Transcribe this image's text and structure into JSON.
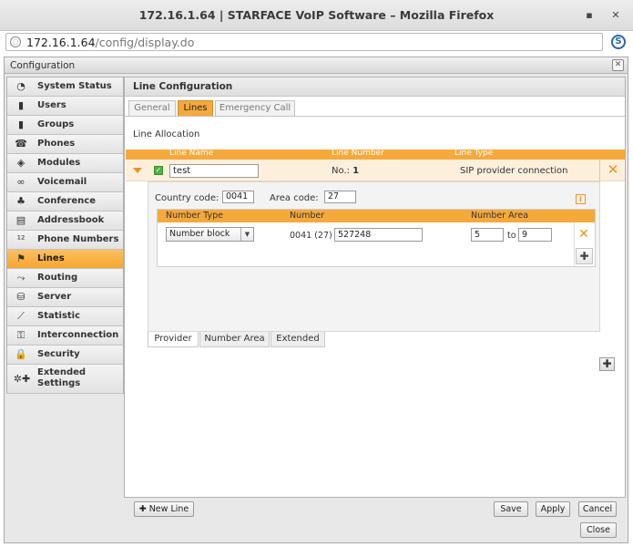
{
  "browser": {
    "title": "172.16.1.64 | STARFACE VoIP Software – Mozilla Firefox",
    "url_host": "172.16.1.64",
    "url_path": "/config/display.do",
    "minimize": "▪",
    "close": "✕",
    "extension": "S"
  },
  "dialog": {
    "title": "Configuration",
    "close": "✕"
  },
  "sidebar": {
    "items": [
      {
        "label": "System Status",
        "icon": "◔"
      },
      {
        "label": "Users",
        "icon": "▮"
      },
      {
        "label": "Groups",
        "icon": "▮"
      },
      {
        "label": "Phones",
        "icon": "☎"
      },
      {
        "label": "Modules",
        "icon": "◈"
      },
      {
        "label": "Voicemail",
        "icon": "∞"
      },
      {
        "label": "Conference",
        "icon": "♣"
      },
      {
        "label": "Addressbook",
        "icon": "▤"
      },
      {
        "label": "Phone Numbers",
        "icon": "¹²"
      },
      {
        "label": "Lines",
        "icon": "⚑"
      },
      {
        "label": "Routing",
        "icon": "⤳"
      },
      {
        "label": "Server",
        "icon": "⛁"
      },
      {
        "label": "Statistic",
        "icon": "⟋"
      },
      {
        "label": "Interconnection",
        "icon": "⚿"
      },
      {
        "label": "Security",
        "icon": "🔒"
      },
      {
        "label": "Extended Settings",
        "icon": "✲✚"
      }
    ],
    "active": "Lines"
  },
  "main": {
    "title": "Line Configuration",
    "tabs": [
      "General",
      "Lines",
      "Emergency Call"
    ],
    "active_tab": "Lines",
    "section_title": "Line Allocation",
    "grid_headers": [
      "Line Name",
      "Line Number",
      "Line Type"
    ],
    "line": {
      "name": "test",
      "number_label": "No.:",
      "number": "1",
      "type": "SIP provider connection",
      "enabled": true
    },
    "detail": {
      "country_code_label": "Country code:",
      "country_code": "0041",
      "area_code_label": "Area code:",
      "area_code": "27",
      "info": "i",
      "sub_headers": [
        "Number Type",
        "Number",
        "Number Area"
      ],
      "number_type": "Number block",
      "number_prefix": "0041 (27)",
      "number": "527248",
      "area_from": "5",
      "to_label": "to",
      "area_to": "9"
    },
    "bottom_tabs": [
      "Provider",
      "Number Area",
      "Extended"
    ],
    "active_bottom_tab": "Provider"
  },
  "footer": {
    "new_line": "New Line",
    "save": "Save",
    "apply": "Apply",
    "cancel": "Cancel",
    "close": "Close"
  }
}
